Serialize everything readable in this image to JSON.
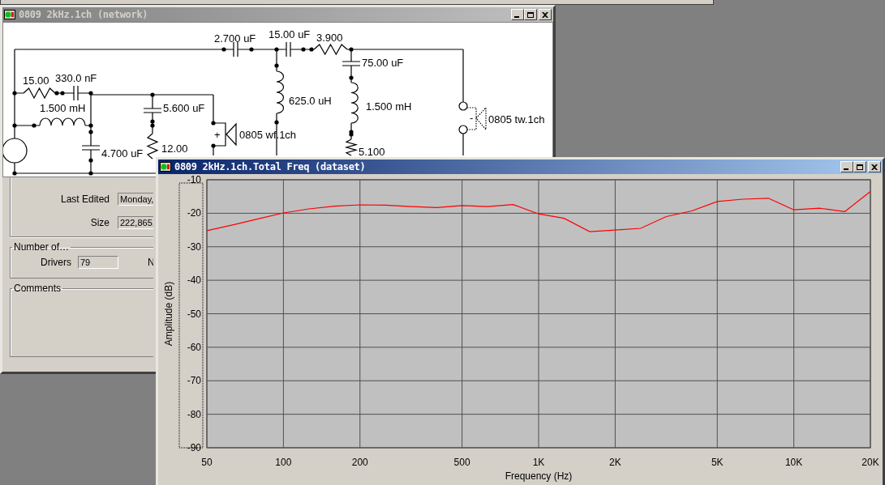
{
  "network_window": {
    "title": "0809 2kHz.1ch (network)",
    "active": false,
    "component_labels": [
      {
        "text": "2.700 uF"
      },
      {
        "text": "15.00 uF"
      },
      {
        "text": "3.900"
      },
      {
        "text": "75.00 uF"
      },
      {
        "text": "625.0 uH"
      },
      {
        "text": "1.500 mH"
      },
      {
        "text": "5.100"
      },
      {
        "text": "-"
      },
      {
        "text": "0805 tw.1ch"
      },
      {
        "text": "15.00"
      },
      {
        "text": "330.0 nF"
      },
      {
        "text": "1.500 mH"
      },
      {
        "text": "5.600 uF"
      },
      {
        "text": "4.700 uF"
      },
      {
        "text": "12.00"
      },
      {
        "text": "+"
      },
      {
        "text": "0805 wf.1ch"
      }
    ],
    "properties": {
      "fields": [
        {
          "label": "Last Edited",
          "value": "Monday,"
        },
        {
          "label": "Size",
          "value": "222,865,"
        }
      ],
      "number_of": {
        "title": "Number of…",
        "fields": [
          {
            "label": "Drivers",
            "value": "79"
          }
        ],
        "column_2_label": "N"
      },
      "comments": {
        "title": "Comments"
      }
    }
  },
  "chart_window": {
    "title": "0809 2kHz.1ch.Total Freq (dataset)",
    "active": true,
    "chart_data": {
      "type": "line",
      "grid": true,
      "xlabel": "Frequency (Hz)",
      "ylabel": "Amplitude (dB)",
      "categories": [
        "50",
        null,
        null,
        "100",
        null,
        null,
        "200",
        null,
        null,
        null,
        "500",
        null,
        null,
        "1K",
        null,
        null,
        "2K",
        null,
        null,
        null,
        "5K",
        null,
        null,
        "10K",
        null,
        null,
        "20K"
      ],
      "series": [
        {
          "color": "#ff0000",
          "values": [
            -25.2,
            -23.5,
            -21.7,
            -19.9,
            -18.7,
            -17.9,
            -17.5,
            -17.6,
            -18,
            -18.3,
            -17.7,
            -18,
            -17.4,
            -20.2,
            -21.5,
            -25.5,
            -25,
            -24.5,
            -21,
            -19.3,
            -16.5,
            -15.8,
            -15.5,
            -19,
            -18.5,
            -19.5,
            -13.5
          ]
        }
      ],
      "ylim": [
        -90,
        -10
      ],
      "yticks": [
        -10,
        -20,
        -30,
        -40,
        -50,
        -60,
        -70,
        -80,
        -90
      ]
    }
  }
}
